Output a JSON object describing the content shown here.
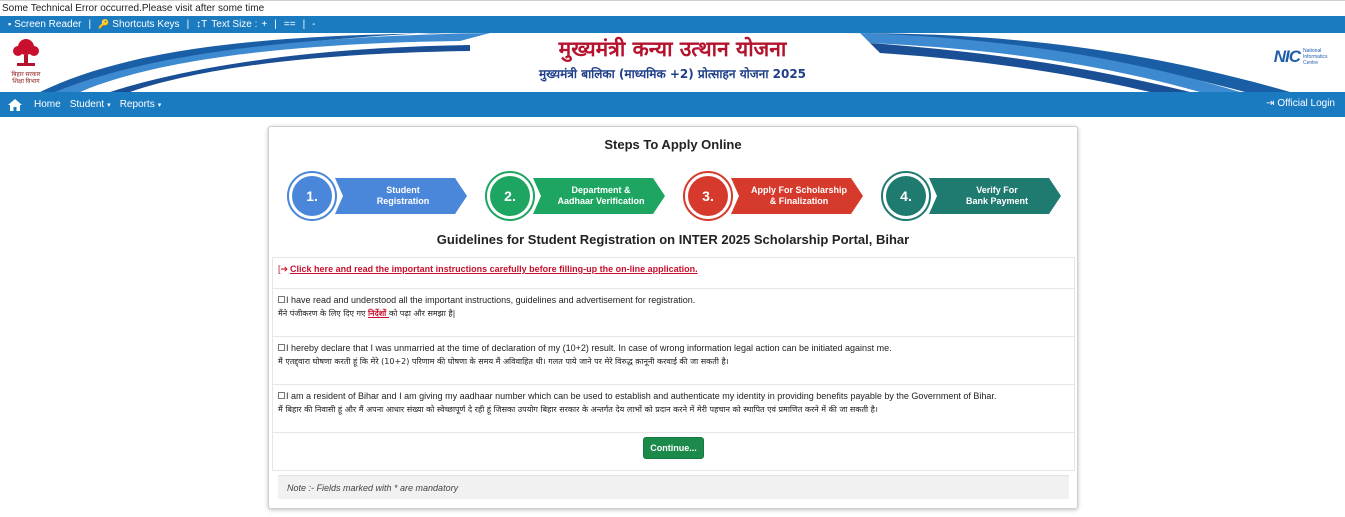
{
  "error_message": "Some Technical Error occurred.Please visit after some time",
  "accessibility": {
    "screen_reader": "Screen Reader",
    "shortcuts": "Shortcuts Keys",
    "text_size_label": "Text Size :",
    "increase": "+",
    "normal": "==",
    "decrease": "-"
  },
  "banner": {
    "title": "मुख्यमंत्री कन्या उत्थान योजना",
    "subtitle": "मुख्यमंत्री बालिका (माध्यमिक +2) प्रोत्साहन योजना 2025",
    "left_logo_text_1": "बिहार सरकार",
    "left_logo_text_2": "शिक्षा विभाग",
    "nic_logo": "NIC",
    "nic_text": "National Informatics Centre"
  },
  "nav": {
    "home": "Home",
    "student": "Student",
    "reports": "Reports",
    "official_login": "Official Login"
  },
  "steps_title": "Steps To Apply Online",
  "steps": [
    {
      "number": "1.",
      "line1": "Student",
      "line2": "Registration",
      "color": "#4a86d9"
    },
    {
      "number": "2.",
      "line1": "Department &",
      "line2": "Aadhaar Verification",
      "color": "#1ea561"
    },
    {
      "number": "3.",
      "line1": "Apply For Scholarship",
      "line2": "& Finalization",
      "color": "#d63a2c"
    },
    {
      "number": "4.",
      "line1": "Verify For",
      "line2": "Bank Payment",
      "color": "#1f7a70"
    }
  ],
  "guidelines_title": "Guidelines for Student Registration on INTER 2025 Scholarship Portal, Bihar",
  "instructions_link": "Click here and read the important instructions carefully before filling-up the on-line application.",
  "declarations": [
    {
      "en": "I have read and understood all the important instructions, guidelines and advertisement for registration.",
      "hi_before": "मैंने पंजीकरण के लिए दिए गए ",
      "hi_link": "निर्देशों ",
      "hi_after": "को पढ़ा और समझा है|"
    },
    {
      "en": "I hereby declare that I was unmarried at the time of declaration of my (10+2) result. In case of wrong information legal action can be initiated against me.",
      "hi": "मैं एतद्द्वारा घोषणा करती हूं कि मेरे (10+2) परिणाम की घोषणा के समय मैं अविवाहित थी। गलत पाये जाने पर मेरे विरुद्ध क़ानूनी करवाई की जा सकती है।"
    },
    {
      "en": "I am a resident of Bihar and I am giving my aadhaar number which can be used to establish and authenticate my identity in providing benefits payable by the Government of Bihar.",
      "hi": "मैं बिहार की निवासी हूं और मैं अपना आधार संख्या को स्वेच्छापूर्ण दे रही हूं जिसका उपयोग बिहार सरकार के अन्तर्गत देय लाभों को प्रदान करने में मेरी पहचान को स्थापित एवं प्रमाणित करने में की जा सकती है।"
    }
  ],
  "continue_label": "Continue...",
  "note": "Note :- Fields marked with * are mandatory",
  "colors": {
    "primary_blue": "#1a7bc1",
    "title_red": "#b5122e",
    "title_navy": "#1f3f8a",
    "button_green": "#1b8a4a",
    "link_red": "#c8102e"
  }
}
